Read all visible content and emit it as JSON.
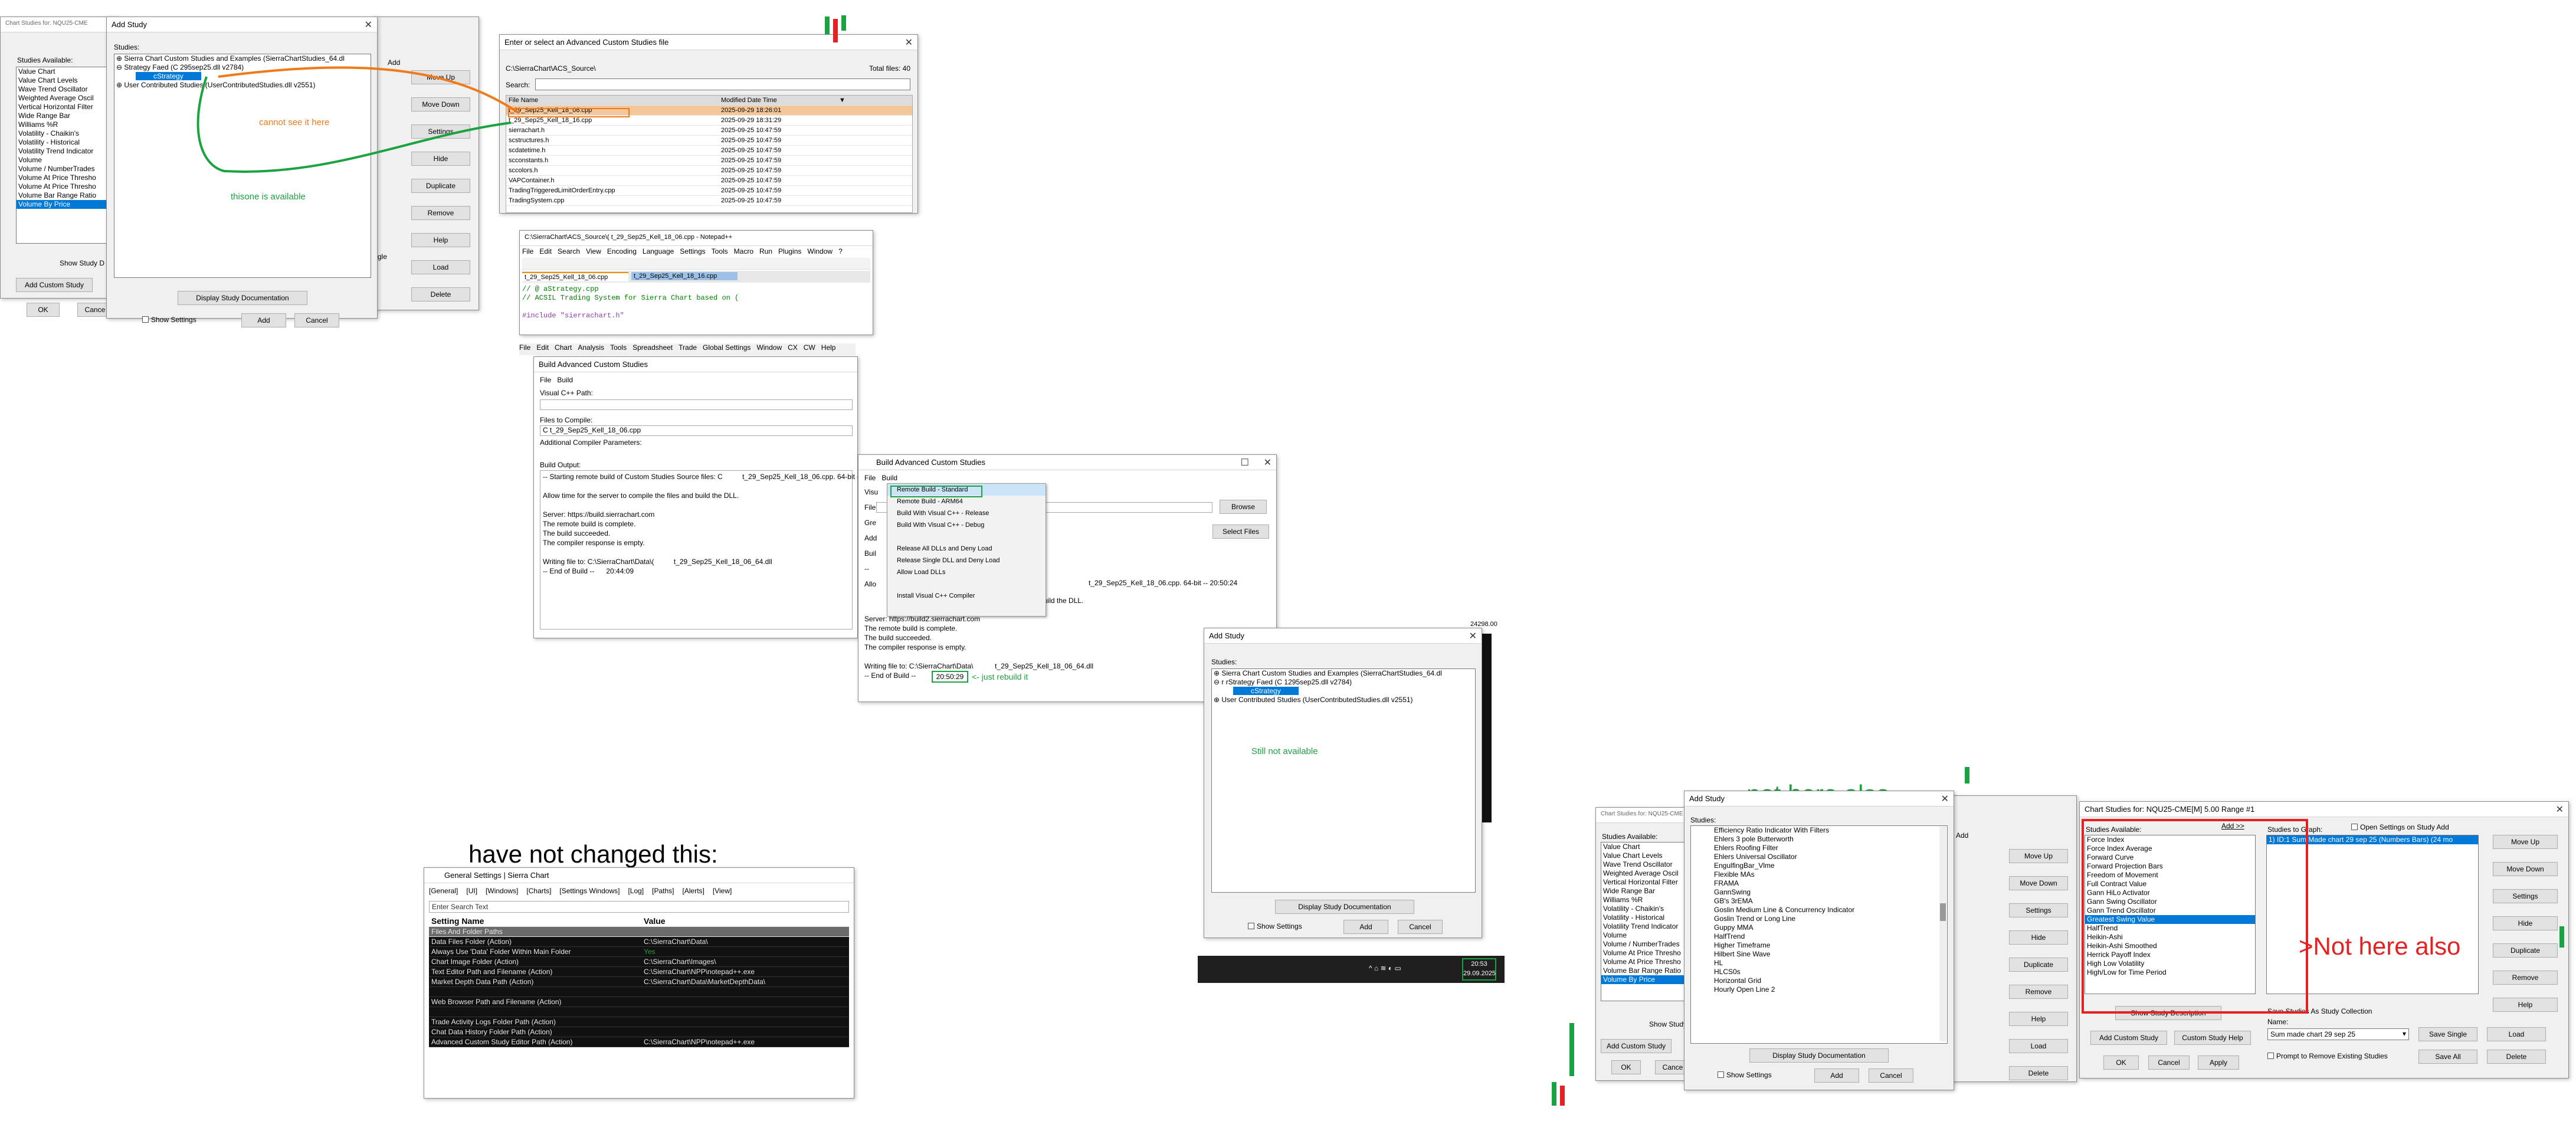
{
  "colors": {
    "green": "#1aa340",
    "orange": "#f07a1a",
    "red": "#e52121",
    "blue": "#0078d7"
  },
  "bg_left": {
    "title": "Chart Studies for: NQU25-CME",
    "available_label": "Studies Available:",
    "items": [
      "Value Chart",
      "Value Chart Levels",
      "Wave Trend Oscillator",
      "Weighted Average Oscil",
      "Vertical Horizontal Filter",
      "Wide Range Bar",
      "Williams %R",
      "Volatility - Chaikin's",
      "Volatility - Historical",
      "Volatility Trend Indicator",
      "Volume",
      "Volume / NumberTrades",
      "Volume At Price Thresho",
      "Volume At Price Thresho",
      "Volume Bar Range Ratio",
      "Volume By Price"
    ],
    "show_study": "Show Study D",
    "add_custom": "Add Custom Study",
    "ok": "OK",
    "cancel": "Cance"
  },
  "add_study1": {
    "title": "Add Study",
    "studies_label": "Studies:",
    "tree": [
      "Sierra Chart Custom Studies and Examples (SierraChartStudies_64.dl",
      "Strategy Faed (C          295sep25.dll v2784)",
      "User Contributed Studies (UserContributedStudies.dll v2551)"
    ],
    "selected": "cStrategy",
    "annot_orange": "cannot see it here",
    "annot_green": "thisone is available",
    "display_doc": "Display Study Documentation",
    "show_settings": "Show Settings",
    "add": "Add",
    "cancel": "Cancel",
    "right_add": "Add",
    "right_buttons": [
      "Move Up",
      "Move Down",
      "Settings",
      "Hide",
      "Duplicate",
      "Remove",
      "Help",
      "Load",
      "Delete"
    ],
    "right_stub": [
      "gle"
    ]
  },
  "file_dlg": {
    "title": "Enter or select an Advanced Custom Studies file",
    "path": "C:\\SierraChart\\ACS_Source\\",
    "total": "Total files: 40",
    "search_label": "Search:",
    "headers": [
      "File Name",
      "Modified Date Time",
      ""
    ],
    "rows": [
      [
        "t_29_Sep25_Kell_18_06.cpp",
        "2025-09-29 18:26:01"
      ],
      [
        "t_29_Sep25_Kell_18_16.cpp",
        "2025-09-29 18:31:29"
      ],
      [
        "sierrachart.h",
        "2025-09-25 10:47:59"
      ],
      [
        "scstructures.h",
        "2025-09-25 10:47:59"
      ],
      [
        "scdatetime.h",
        "2025-09-25 10:47:59"
      ],
      [
        "scconstants.h",
        "2025-09-25 10:47:59"
      ],
      [
        "sccolors.h",
        "2025-09-25 10:47:59"
      ],
      [
        "VAPContainer.h",
        "2025-09-25 10:47:59"
      ],
      [
        "TradingTriggeredLimitOrderEntry.cpp",
        "2025-09-25 10:47:59"
      ],
      [
        "TradingSystem.cpp",
        "2025-09-25 10:47:59"
      ]
    ]
  },
  "npp": {
    "title": "C:\\SierraChart\\ACS_Source\\(          t_29_Sep25_Kell_18_06.cpp - Notepad++",
    "menu": [
      "File",
      "Edit",
      "Search",
      "View",
      "Encoding",
      "Language",
      "Settings",
      "Tools",
      "Macro",
      "Run",
      "Plugins",
      "Window",
      "?"
    ],
    "tab1": "t_29_Sep25_Kell_18_06.cpp",
    "tab2": "t_29_Sep25_Kell_18_16.cpp",
    "lines": [
      "// @           aStrategy.cpp",
      "// ACSIL Trading System for Sierra Chart based on (",
      "",
      "#include \"sierrachart.h\""
    ]
  },
  "sc_menu": [
    "File",
    "Edit",
    "Chart",
    "Analysis",
    "Tools",
    "Spreadsheet",
    "Trade",
    "Global Settings",
    "Window",
    "CX",
    "CW",
    "Help"
  ],
  "build1": {
    "title": "Build Advanced Custom Studies",
    "menu": [
      "File",
      "Build"
    ],
    "vc_label": "Visual C++ Path:",
    "files_label": "Files to Compile:",
    "files": "C         t_29_Sep25_Kell_18_06.cpp",
    "params_label": "Additional Compiler Parameters:",
    "output_label": "Build Output:",
    "output": [
      "-- Starting remote build of Custom Studies Source files: C          t_29_Sep25_Kell_18_06.cpp. 64-bit -- 20:44:08",
      "",
      "Allow time for the server to compile the files and build the DLL.",
      "",
      "Server: https://build.sierrachart.com",
      "The remote build is complete.",
      "The build succeeded.",
      "The compiler response is empty.",
      "",
      "Writing file to: C:\\SierraChart\\Data\\(          t_29_Sep25_Kell_18_06_64.dll",
      "-- End of Build --      20:44:09"
    ]
  },
  "build2": {
    "title": "Build Advanced Custom Studies",
    "menu": [
      "File",
      "Build"
    ],
    "menu_items": [
      "Remote Build - Standard",
      "Remote Build - ARM64",
      "Build With Visual C++ - Release",
      "Build With Visual C++ - Debug",
      "",
      "Release All DLLs and Deny Load",
      "Release Single DLL and Deny Load",
      "Allow Load DLLs",
      "",
      "Install Visual C++ Compiler"
    ],
    "browse": "Browse",
    "select_files": "Select Files",
    "left_stubs": [
      "Visu",
      "File",
      "Gre",
      "Add",
      "Buil",
      "--",
      "Allo"
    ],
    "output_mid": "t_29_Sep25_Kell_18_06.cpp. 64-bit --      20:50:24",
    "output_mid2": "uild the DLL.",
    "output": [
      "Server: https://build2.sierrachart.com",
      "The remote build is complete.",
      "The build succeeded.",
      "The compiler response is empty.",
      "",
      "Writing file to: C:\\SierraChart\\Data\\           t_29_Sep25_Kell_18_06_64.dll",
      "-- End of Build --"
    ],
    "time": "20:50:29",
    "annot": "<- just rebuild it"
  },
  "add_study2": {
    "title": "Add Study",
    "studies_label": "Studies:",
    "tree": [
      "Sierra Chart Custom Studies and Examples (SierraChartStudies_64.dl",
      "r         rStrategy Faed (C          1295sep25.dll v2784)",
      "User Contributed Studies (UserContributedStudies.dll v2551)"
    ],
    "selected": "cStrategy",
    "annot": "Still not available",
    "display_doc": "Display Study Documentation",
    "show_settings": "Show Settings",
    "add": "Add",
    "cancel": "Cancel",
    "price": "24298.00",
    "taskbar_time": "20:53",
    "taskbar_date": "29.09.2025"
  },
  "general": {
    "heading": "have not changed this:",
    "title": "General Settings | Sierra Chart",
    "menu": [
      "[General]",
      "[UI]",
      "[Windows]",
      "[Charts]",
      "[Settings Windows]",
      "[Log]",
      "[Paths]",
      "[Alerts]",
      "[View]"
    ],
    "search": "Enter Search Text",
    "col_name": "Setting Name",
    "col_value": "Value",
    "section": "Files And Folder Paths",
    "rows": [
      [
        "Data Files Folder (Action)",
        "C:\\SierraChart\\Data\\"
      ],
      [
        "Always Use 'Data' Folder Within Main Folder",
        "Yes"
      ],
      [
        "Chart Image Folder (Action)",
        "C:\\SierraChart\\Images\\"
      ],
      [
        "Text Editor Path and Filename (Action)",
        "C:\\SierraChart\\NPP\\notepad++.exe"
      ],
      [
        "Market Depth Data Path (Action)",
        "C:\\SierraChart\\Data\\MarketDepthData\\"
      ],
      [
        "",
        ""
      ],
      [
        "Web Browser Path and Filename (Action)",
        ""
      ],
      [
        "",
        ""
      ],
      [
        "Trade Activity Logs Folder Path (Action)",
        ""
      ],
      [
        "Chat Data History Folder Path (Action)",
        ""
      ],
      [
        "Advanced Custom Study Editor Path (Action)",
        "C:\\SierraChart\\NPP\\notepad++.exe"
      ]
    ]
  },
  "add_study3": {
    "title": "Add Study",
    "annot": "not here also",
    "studies_label": "Studies:",
    "items": [
      "Efficiency Ratio Indicator With Filters",
      "Ehlers 3 pole Butterworth",
      "Ehlers Roofing Filter",
      "Ehlers Universal Oscillator",
      "EngulfingBar_Vlme",
      "Flexible MAs",
      "FRAMA",
      "GannSwing",
      "GB's 3rEMA",
      "Goslin Medium Line & Concurrency Indicator",
      "Goslin Trend or Long Line",
      "Guppy MMA",
      "HalfTrend",
      "Higher Timeframe",
      "Hilbert Sine Wave",
      "HL",
      "HLCS0s",
      "Horizontal Grid",
      "Hourly Open Line 2"
    ],
    "display_doc": "Display Study Documentation",
    "show_settings": "Show Settings",
    "add": "Add",
    "cancel": "Cancel",
    "right_add": "Add",
    "right_buttons": [
      "Move Up",
      "Move Down",
      "Settings",
      "Hide",
      "Duplicate",
      "Remove",
      "Help",
      "Load",
      "Delete"
    ]
  },
  "chart_studies": {
    "title": "Chart Studies for: NQU25-CME[M]  5.00 Range  #1",
    "available_label": "Studies Available:",
    "add_btn": "Add >>",
    "items": [
      "Force Index",
      "Force Index Average",
      "Forward Curve",
      "Forward Projection Bars",
      "Freedom of Movement",
      "Full Contract Value",
      "Gann HiLo Activator",
      "Gann Swing Oscillator",
      "Gann Trend Oscillator",
      "Greatest Swing Value",
      "HalfTrend",
      "Heikin-Ashi",
      "Heikin-Ashi Smoothed",
      "Herrick Payoff Index",
      "High Low Volatility",
      "High/Low for Time Period"
    ],
    "selected_index": 9,
    "graph_label": "Studies to Graph:",
    "graph_item": "1) ID:1  Sum Made chart 29 sep 25 (Numbers Bars) (24 mo",
    "open_settings": "Open Settings on Study Add",
    "annot": ">Not here also",
    "right_buttons": [
      "Move Up",
      "Move Down",
      "Settings",
      "Hide",
      "Duplicate",
      "Remove",
      "Help"
    ],
    "show_desc": "Show Study Description",
    "add_custom": "Add Custom Study",
    "custom_help": "Custom Study Help",
    "ok": "OK",
    "cancel": "Cancel",
    "apply": "Apply",
    "collection": "Save Studies As Study Collection",
    "name_label": "Name:",
    "name_value": "Sum made chart 29 sep 25",
    "save_single": "Save Single",
    "load": "Load",
    "save_all": "Save All",
    "delete": "Delete",
    "prompt": "Prompt to Remove Existing Studies"
  },
  "bg_right": {
    "title": "Chart Studies for: NQU25-CME",
    "available_label": "Studies Available:",
    "items": [
      "Value Chart",
      "Value Chart Levels",
      "Wave Trend Oscillator",
      "Weighted Average Oscil",
      "Vertical Horizontal Filter",
      "Wide Range Bar",
      "Williams %R",
      "Volatility - Chaikin's",
      "Volatility - Historical",
      "Volatility Trend Indicator",
      "Volume",
      "Volume / NumberTrades",
      "Volume At Price Thresho",
      "Volume At Price Thresho",
      "Volume Bar Range Ratio",
      "Volume By Price"
    ],
    "show_study": "Show Study D",
    "add_custom": "Add Custom Study",
    "ok": "OK",
    "cancel": "Cance"
  }
}
